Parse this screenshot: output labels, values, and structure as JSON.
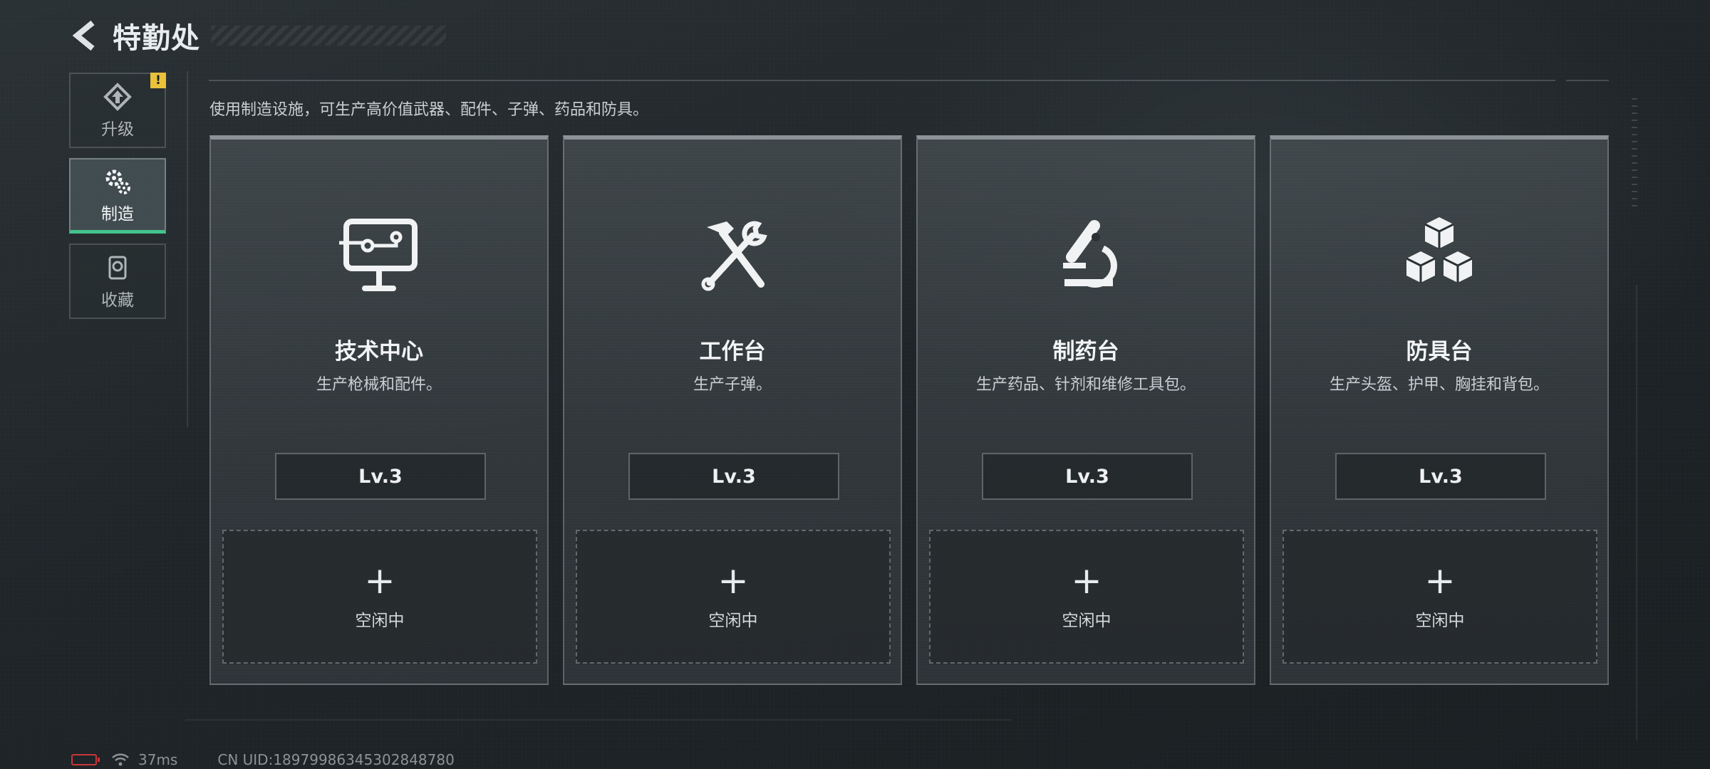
{
  "header": {
    "title": "特勤处"
  },
  "sidebar": {
    "tabs": [
      {
        "label": "升级",
        "icon": "upgrade-icon",
        "active": false,
        "badge": "!"
      },
      {
        "label": "制造",
        "icon": "gear-manufacture-icon",
        "active": true
      },
      {
        "label": "收藏",
        "icon": "collection-icon",
        "active": false
      }
    ]
  },
  "description": "使用制造设施，可生产高价值武器、配件、子弹、药品和防具。",
  "cards": [
    {
      "title": "技术中心",
      "subtitle": "生产枪械和配件。",
      "level": "Lv.3",
      "slot_plus": "+",
      "slot_status": "空闲中",
      "icon": "computer-icon"
    },
    {
      "title": "工作台",
      "subtitle": "生产子弹。",
      "level": "Lv.3",
      "slot_plus": "+",
      "slot_status": "空闲中",
      "icon": "hammer-wrench-icon"
    },
    {
      "title": "制药台",
      "subtitle": "生产药品、针剂和维修工具包。",
      "level": "Lv.3",
      "slot_plus": "+",
      "slot_status": "空闲中",
      "icon": "microscope-icon"
    },
    {
      "title": "防具台",
      "subtitle": "生产头盔、护甲、胸挂和背包。",
      "level": "Lv.3",
      "slot_plus": "+",
      "slot_status": "空闲中",
      "icon": "boxes-icon"
    }
  ],
  "status_bar": {
    "ping": "37ms",
    "uid": "CN UID:18979986345302848780"
  },
  "colors": {
    "accent_green": "#43c38d",
    "warning_yellow": "#e9c13a",
    "battery_red": "#c8363a"
  }
}
